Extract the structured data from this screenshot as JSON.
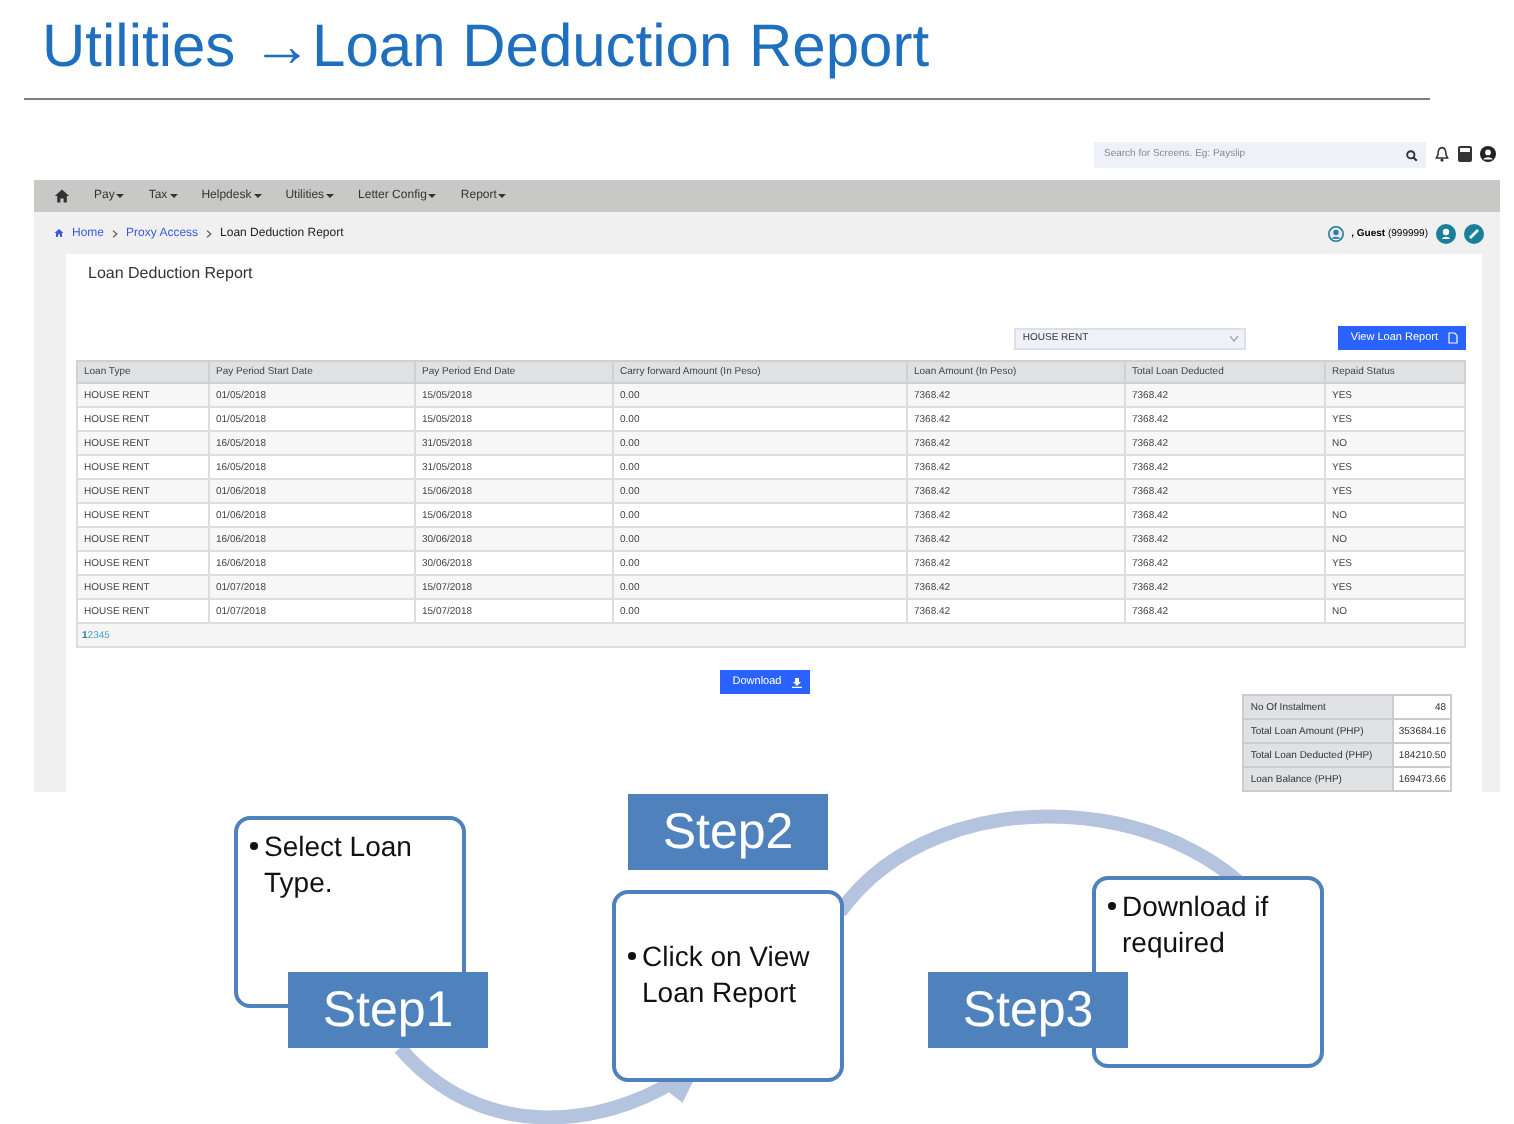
{
  "slide": {
    "title": "Utilities →Loan Deduction Report"
  },
  "app": {
    "search": {
      "placeholder": "Search for Screens. Eg: Payslip"
    },
    "nav": [
      "Pay",
      "Tax",
      "Helpdesk",
      "Utilities",
      "Letter Config",
      "Report"
    ],
    "breadcrumb": [
      {
        "label": "Home",
        "current": false
      },
      {
        "label": "Proxy Access",
        "current": false
      },
      {
        "label": "Loan Deduction Report",
        "current": true
      }
    ],
    "user": {
      "name": ", Guest",
      "id": "(999999)"
    },
    "card_title": "Loan Deduction Report",
    "loan_type_select": {
      "value": "HOUSE RENT"
    },
    "view_button": "View Loan Report",
    "table": {
      "columns": [
        "Loan Type",
        "Pay Period Start Date",
        "Pay Period End Date",
        "Carry forward Amount (In Peso)",
        "Loan Amount (In Peso)",
        "Total Loan Deducted",
        "Repaid Status"
      ],
      "rows": [
        [
          "HOUSE RENT",
          "01/05/2018",
          "15/05/2018",
          "0.00",
          "7368.42",
          "7368.42",
          "YES"
        ],
        [
          "HOUSE RENT",
          "01/05/2018",
          "15/05/2018",
          "0.00",
          "7368.42",
          "7368.42",
          "YES"
        ],
        [
          "HOUSE RENT",
          "16/05/2018",
          "31/05/2018",
          "0.00",
          "7368.42",
          "7368.42",
          "NO"
        ],
        [
          "HOUSE RENT",
          "16/05/2018",
          "31/05/2018",
          "0.00",
          "7368.42",
          "7368.42",
          "YES"
        ],
        [
          "HOUSE RENT",
          "01/06/2018",
          "15/06/2018",
          "0.00",
          "7368.42",
          "7368.42",
          "YES"
        ],
        [
          "HOUSE RENT",
          "01/06/2018",
          "15/06/2018",
          "0.00",
          "7368.42",
          "7368.42",
          "NO"
        ],
        [
          "HOUSE RENT",
          "16/06/2018",
          "30/06/2018",
          "0.00",
          "7368.42",
          "7368.42",
          "NO"
        ],
        [
          "HOUSE RENT",
          "16/06/2018",
          "30/06/2018",
          "0.00",
          "7368.42",
          "7368.42",
          "YES"
        ],
        [
          "HOUSE RENT",
          "01/07/2018",
          "15/07/2018",
          "0.00",
          "7368.42",
          "7368.42",
          "YES"
        ],
        [
          "HOUSE RENT",
          "01/07/2018",
          "15/07/2018",
          "0.00",
          "7368.42",
          "7368.42",
          "NO"
        ]
      ]
    },
    "pagination": [
      {
        "label": "1",
        "selected": true
      },
      {
        "label": "2",
        "selected": false
      },
      {
        "label": "3",
        "selected": false
      },
      {
        "label": "4",
        "selected": false
      },
      {
        "label": "5",
        "selected": false
      }
    ],
    "download_button": "Download",
    "summary": [
      {
        "label": "No Of Instalment",
        "value": "48"
      },
      {
        "label": "Total Loan Amount (PHP)",
        "value": "353684.16"
      },
      {
        "label": "Total Loan Deducted (PHP)",
        "value": "184210.50"
      },
      {
        "label": "Loan Balance (PHP)",
        "value": "169473.66"
      }
    ]
  },
  "steps": [
    {
      "label": "Step1",
      "text": "Select Loan Type."
    },
    {
      "label": "Step2",
      "text": "Click on View Loan Report"
    },
    {
      "label": "Step3",
      "text": "Download if required"
    }
  ]
}
